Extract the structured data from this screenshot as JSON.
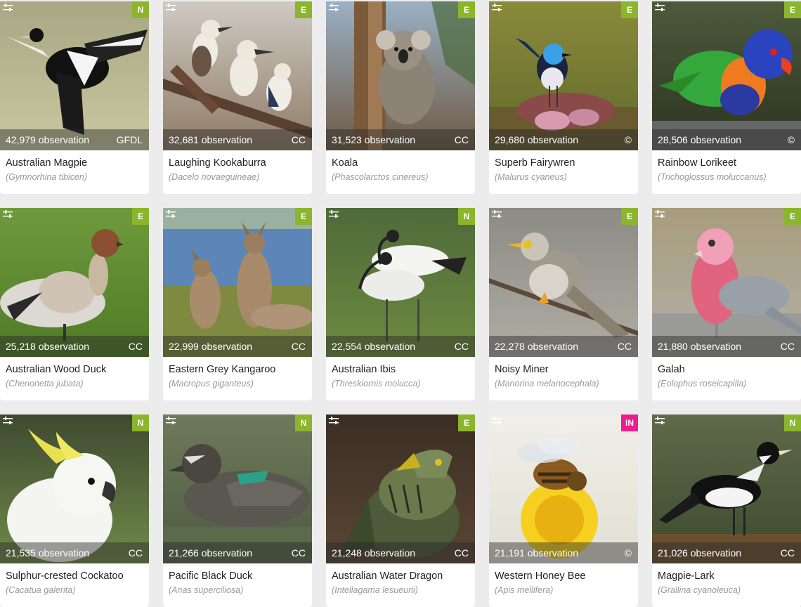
{
  "colors": {
    "N": "#8bb52d",
    "E": "#8bb52d",
    "IN": "#ee1c8f"
  },
  "cards": [
    {
      "common": "Australian Magpie",
      "scientific": "(Gymnorhina tibicen)",
      "observations": "42,979 observation",
      "license": "GFDL",
      "status": "N",
      "subject": "magpie",
      "bg": [
        "#a9a784",
        "#c9c8a0"
      ]
    },
    {
      "common": "Laughing Kookaburra",
      "scientific": "(Dacelo novaeguineae)",
      "observations": "32,681 observation",
      "license": "CC",
      "status": "E",
      "subject": "kookaburra",
      "bg": [
        "#cfcac2",
        "#8e7b66"
      ]
    },
    {
      "common": "Koala",
      "scientific": "(Phascolarctos cinereus)",
      "observations": "31,523 observation",
      "license": "CC",
      "status": "E",
      "subject": "koala",
      "bg": [
        "#9ab0c4",
        "#6e5a44"
      ]
    },
    {
      "common": "Superb Fairywren",
      "scientific": "(Malurus cyaneus)",
      "observations": "29,680 observation",
      "license": "©",
      "status": "E",
      "subject": "fairywren",
      "bg": [
        "#8b8a3c",
        "#5f6a2a"
      ]
    },
    {
      "common": "Rainbow Lorikeet",
      "scientific": "(Trichoglossus moluccanus)",
      "observations": "28,506 observation",
      "license": "©",
      "status": "E",
      "subject": "lorikeet",
      "bg": [
        "#4c5a3c",
        "#2c3420"
      ]
    },
    {
      "common": "Australian Wood Duck",
      "scientific": "(Chenonetta jubata)",
      "observations": "25,218 observation",
      "license": "CC",
      "status": "E",
      "subject": "woodduck",
      "bg": [
        "#6f9a3c",
        "#507a26"
      ]
    },
    {
      "common": "Eastern Grey Kangaroo",
      "scientific": "(Macropus giganteus)",
      "observations": "22,999 observation",
      "license": "CC",
      "status": "E",
      "subject": "kangaroo",
      "bg": [
        "#5d86b7",
        "#8d8d4a"
      ]
    },
    {
      "common": "Australian Ibis",
      "scientific": "(Threskiornis molucca)",
      "observations": "22,554 observation",
      "license": "CC",
      "status": "N",
      "subject": "ibis",
      "bg": [
        "#4f6a3a",
        "#6d8a40"
      ]
    },
    {
      "common": "Noisy Miner",
      "scientific": "(Manorina melanocephala)",
      "observations": "22,278 observation",
      "license": "CC",
      "status": "E",
      "subject": "miner",
      "bg": [
        "#8c8c84",
        "#b0aca4"
      ]
    },
    {
      "common": "Galah",
      "scientific": "(Eolophus roseicapilla)",
      "observations": "21,880 observation",
      "license": "CC",
      "status": "E",
      "subject": "galah",
      "bg": [
        "#a89c7c",
        "#b4b0a8"
      ]
    },
    {
      "common": "Sulphur-crested Cockatoo",
      "scientific": "(Cacatua galerita)",
      "observations": "21,535 observation",
      "license": "CC",
      "status": "N",
      "subject": "cockatoo",
      "bg": [
        "#3e4a30",
        "#6f8a4a"
      ]
    },
    {
      "common": "Pacific Black Duck",
      "scientific": "(Anas superciliosa)",
      "observations": "21,266 observation",
      "license": "CC",
      "status": "N",
      "subject": "blackduck",
      "bg": [
        "#6e7a5a",
        "#4e5a40"
      ]
    },
    {
      "common": "Australian Water Dragon",
      "scientific": "(Intellagama lesueurii)",
      "observations": "21,248 observation",
      "license": "CC",
      "status": "E",
      "subject": "dragon",
      "bg": [
        "#3a2e24",
        "#5a4634"
      ]
    },
    {
      "common": "Western Honey Bee",
      "scientific": "(Apis mellifera)",
      "observations": "21,191 observation",
      "license": "©",
      "status": "IN",
      "subject": "bee",
      "bg": [
        "#f0efe8",
        "#e2e0d4"
      ]
    },
    {
      "common": "Magpie-Lark",
      "scientific": "(Grallina cyanoleuca)",
      "observations": "21,026 observation",
      "license": "CC",
      "status": "N",
      "subject": "magpielark",
      "bg": [
        "#5e6a48",
        "#3e4a30"
      ]
    }
  ]
}
